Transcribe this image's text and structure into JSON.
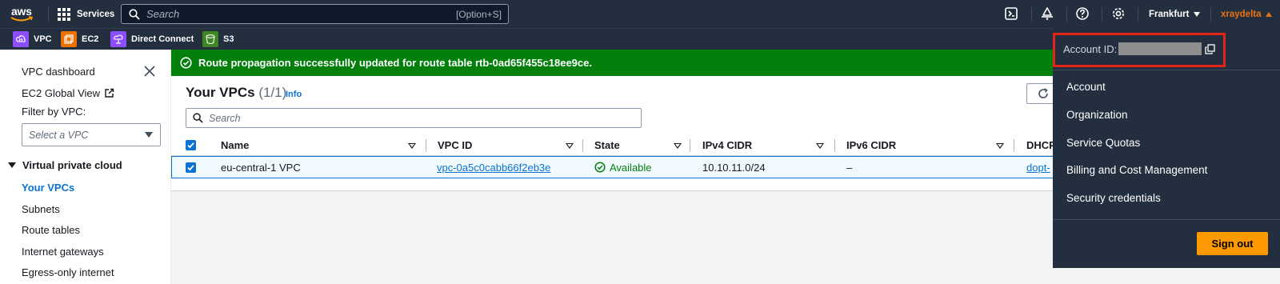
{
  "topnav": {
    "logo_text": "aws",
    "services_label": "Services",
    "search_placeholder": "Search",
    "search_shortcut": "[Option+S]",
    "region": "Frankfurt",
    "user": "xraydelta"
  },
  "favorites": [
    {
      "label": "VPC",
      "color": "#8c4fff"
    },
    {
      "label": "EC2",
      "color": "#ed7100"
    },
    {
      "label": "Direct Connect",
      "color": "#8c4fff"
    },
    {
      "label": "S3",
      "color": "#3f8624"
    }
  ],
  "sidenav": {
    "dashboard": "VPC dashboard",
    "global_view": "EC2 Global View",
    "filter_label": "Filter by VPC:",
    "filter_placeholder": "Select a VPC",
    "section": "Virtual private cloud",
    "items": [
      "Your VPCs",
      "Subnets",
      "Route tables",
      "Internet gateways",
      "Egress-only internet"
    ]
  },
  "flash": {
    "message": "Route propagation successfully updated for route table rtb-0ad65f455c18ee9ce."
  },
  "vpcs": {
    "title": "Your VPCs",
    "count": "(1/1)",
    "info": "Info",
    "search_placeholder": "Search",
    "columns": [
      "Name",
      "VPC ID",
      "State",
      "IPv4 CIDR",
      "IPv6 CIDR",
      "DHCP"
    ],
    "row": {
      "name": "eu-central-1 VPC",
      "vpc_id": "vpc-0a5c0cabb66f2eb3e",
      "state": "Available",
      "ipv4": "10.10.11.0/24",
      "ipv6": "–",
      "dhcp": "dopt-"
    }
  },
  "account_menu": {
    "account_id_label": "Account ID:",
    "items": [
      "Account",
      "Organization",
      "Service Quotas",
      "Billing and Cost Management",
      "Security credentials"
    ],
    "signout": "Sign out"
  },
  "colors": {
    "nav_bg": "#232f3e",
    "success": "#037f0c",
    "link": "#0972d3",
    "accent": "#ff9900",
    "highlight": "#e0251b"
  }
}
